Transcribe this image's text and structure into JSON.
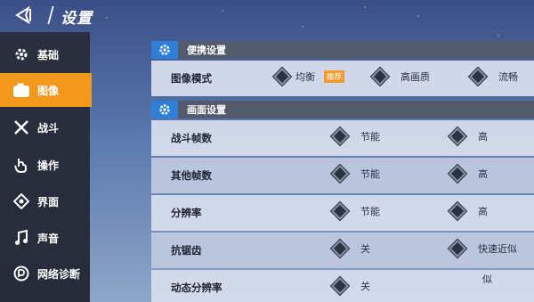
{
  "header": {
    "title": "设置"
  },
  "sidebar": {
    "items": [
      {
        "label": "基础",
        "icon": "gear-icon"
      },
      {
        "label": "图像",
        "icon": "camera-icon",
        "active": true
      },
      {
        "label": "战斗",
        "icon": "crossed-swords-icon"
      },
      {
        "label": "操作",
        "icon": "hand-pointer-icon"
      },
      {
        "label": "界面",
        "icon": "diamond-arrows-icon"
      },
      {
        "label": "声音",
        "icon": "music-note-icon"
      },
      {
        "label": "网络诊断",
        "icon": "network-icon"
      }
    ]
  },
  "sections": {
    "convenient": {
      "title": "便携设置",
      "rows": [
        {
          "label": "图像模式",
          "options": [
            "均衡",
            "高画质",
            "流畅"
          ],
          "badge": "推荐"
        }
      ]
    },
    "picture": {
      "title": "画面设置",
      "rows": [
        {
          "label": "战斗帧数",
          "options": [
            "节能",
            "高"
          ]
        },
        {
          "label": "其他帧数",
          "options": [
            "节能",
            "高"
          ]
        },
        {
          "label": "分辨率",
          "options": [
            "节能",
            "高"
          ]
        },
        {
          "label": "抗锯齿",
          "options": [
            "关",
            "快速近似"
          ]
        },
        {
          "label": "动态分辨率",
          "options": [
            "关",
            "似"
          ]
        }
      ]
    }
  },
  "colors": {
    "accent": "#f2991d",
    "section_header": "#525a6c",
    "gear_tab": "#2f7ed8"
  }
}
